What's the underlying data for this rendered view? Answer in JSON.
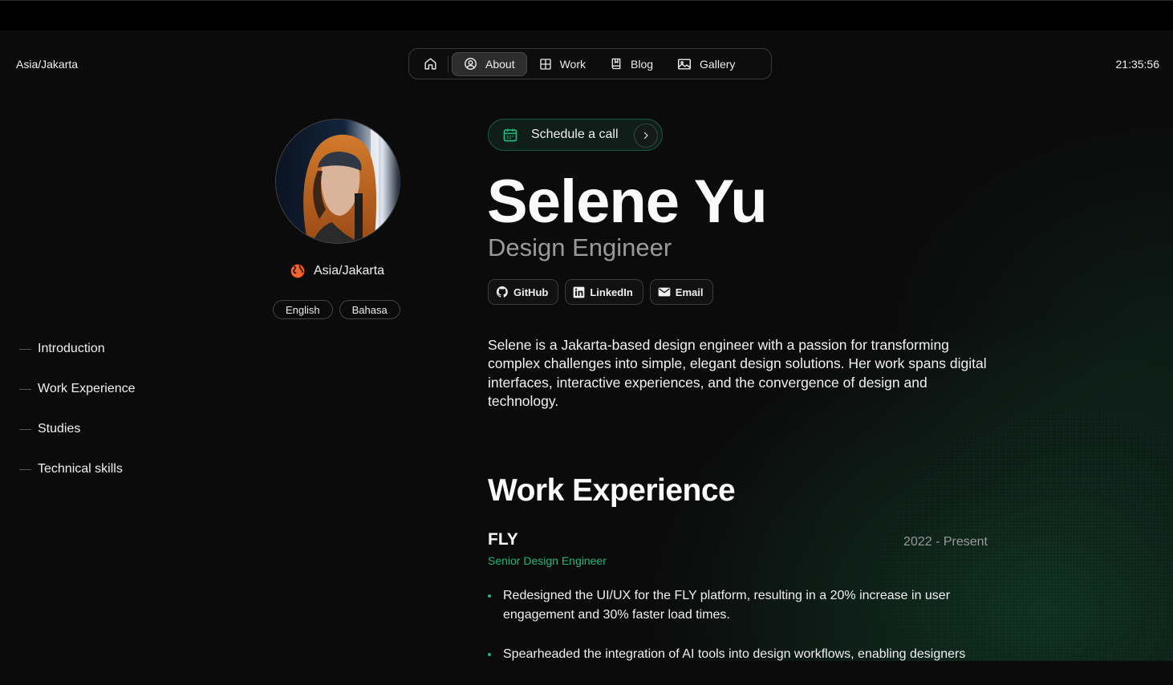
{
  "header": {
    "timezone": "Asia/Jakarta",
    "clock": "21:35:56"
  },
  "nav": {
    "home_icon": "home-icon",
    "items": [
      {
        "label": "About",
        "icon": "user-circle-icon",
        "active": true
      },
      {
        "label": "Work",
        "icon": "grid-icon",
        "active": false
      },
      {
        "label": "Blog",
        "icon": "book-icon",
        "active": false
      },
      {
        "label": "Gallery",
        "icon": "image-icon",
        "active": false
      }
    ]
  },
  "profile": {
    "location": "Asia/Jakarta",
    "languages": [
      "English",
      "Bahasa"
    ]
  },
  "toc": {
    "items": [
      "Introduction",
      "Work Experience",
      "Studies",
      "Technical skills"
    ]
  },
  "hero": {
    "cta_label": "Schedule a call",
    "name": "Selene Yu",
    "role": "Design Engineer",
    "socials": [
      {
        "label": "GitHub",
        "icon": "github-icon"
      },
      {
        "label": "LinkedIn",
        "icon": "linkedin-icon"
      },
      {
        "label": "Email",
        "icon": "email-icon"
      }
    ],
    "bio": "Selene is a Jakarta-based design engineer with a passion for transforming complex challenges into simple, elegant design solutions. Her work spans digital interfaces, interactive experiences, and the convergence of design and technology."
  },
  "work": {
    "heading": "Work Experience",
    "jobs": [
      {
        "company": "FLY",
        "period": "2022 - Present",
        "title": "Senior Design Engineer",
        "bullets": [
          "Redesigned the UI/UX for the FLY platform, resulting in a 20% increase in user engagement and 30% faster load times.",
          "Spearheaded the integration of AI tools into design workflows, enabling designers"
        ]
      }
    ]
  },
  "colors": {
    "accent": "#24b57a",
    "background": "#0b0b0b",
    "globe": "#f2622a"
  }
}
